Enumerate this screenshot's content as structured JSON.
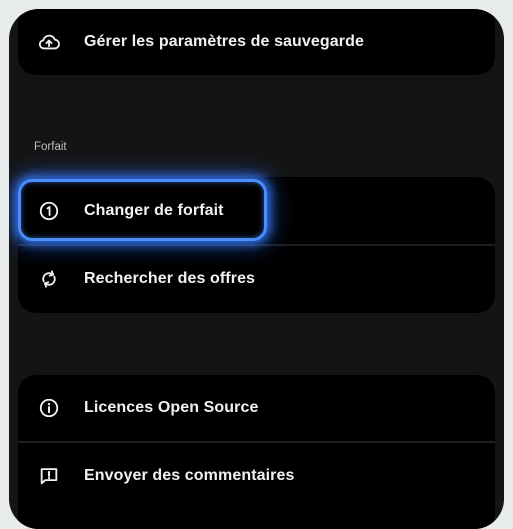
{
  "backup_card": {
    "manage_backup": {
      "icon": "cloud-upload-icon",
      "label": "Gérer les paramètres de sauvegarde"
    }
  },
  "plan_section": {
    "header": "Forfait",
    "items": [
      {
        "icon": "plan-number-one-icon",
        "label": "Changer de forfait",
        "focused": true
      },
      {
        "icon": "sync-icon",
        "label": "Rechercher des offres"
      }
    ]
  },
  "about_card": {
    "items": [
      {
        "icon": "info-icon",
        "label": "Licences Open Source"
      },
      {
        "icon": "feedback-icon",
        "label": "Envoyer des commentaires"
      }
    ]
  },
  "colors": {
    "focus_ring": "#4a8dff",
    "card_background": "#000000",
    "screen_background": "#141414"
  }
}
